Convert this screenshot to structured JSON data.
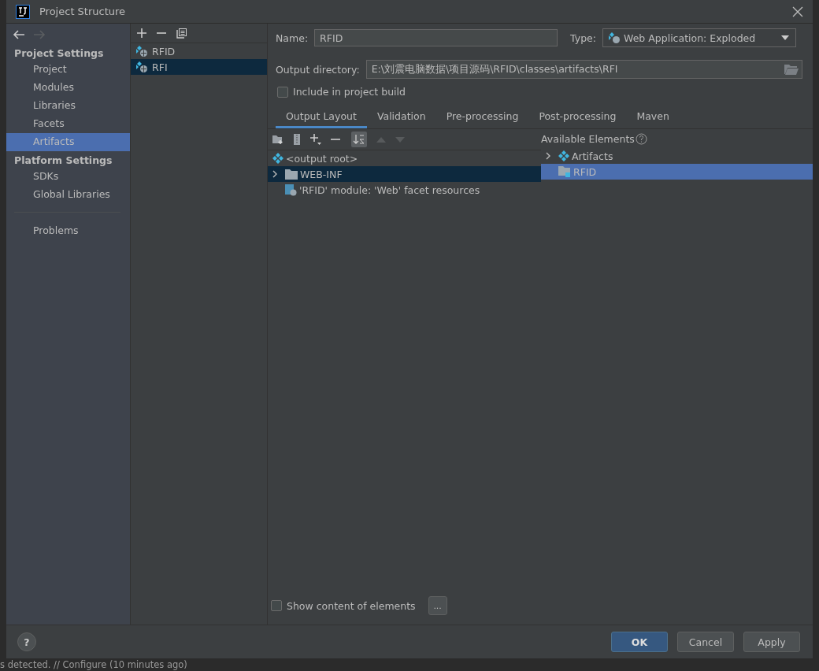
{
  "window": {
    "title": "Project Structure"
  },
  "sidebar": {
    "sections": [
      {
        "heading": "Project Settings",
        "items": [
          {
            "label": "Project",
            "selected": false
          },
          {
            "label": "Modules",
            "selected": false
          },
          {
            "label": "Libraries",
            "selected": false
          },
          {
            "label": "Facets",
            "selected": false
          },
          {
            "label": "Artifacts",
            "selected": true
          }
        ]
      },
      {
        "heading": "Platform Settings",
        "items": [
          {
            "label": "SDKs",
            "selected": false
          },
          {
            "label": "Global Libraries",
            "selected": false
          }
        ]
      }
    ],
    "extra_items": [
      {
        "label": "Problems",
        "selected": false
      }
    ]
  },
  "artifacts": [
    {
      "name": "RFID",
      "selected": false
    },
    {
      "name": "RFI",
      "selected": true
    }
  ],
  "form": {
    "name_label": "Name:",
    "name_value": "RFID",
    "type_label": "Type:",
    "type_value": "Web Application: Exploded",
    "output_label": "Output directory:",
    "output_value": "E:\\刘震电脑数据\\项目源码\\RFID\\classes\\artifacts\\RFI",
    "include_label": "Include in project build",
    "include_checked": false
  },
  "tabs": [
    {
      "label": "Output Layout",
      "selected": true
    },
    {
      "label": "Validation",
      "selected": false
    },
    {
      "label": "Pre-processing",
      "selected": false
    },
    {
      "label": "Post-processing",
      "selected": false
    },
    {
      "label": "Maven",
      "selected": false
    }
  ],
  "layout_tree": [
    {
      "label": "<output root>",
      "kind": "artifact",
      "selected": false,
      "children": [
        {
          "label": "WEB-INF",
          "kind": "folder",
          "expanded": false,
          "selected": true
        },
        {
          "label": "'RFID' module: 'Web' facet resources",
          "kind": "facet",
          "selected": false
        }
      ]
    }
  ],
  "available": {
    "title": "Available Elements",
    "items": [
      {
        "label": "Artifacts",
        "kind": "artifact",
        "expanded": false,
        "selected": false
      },
      {
        "label": "RFID",
        "kind": "module",
        "selected": true
      }
    ]
  },
  "show_content": {
    "label": "Show content of elements",
    "checked": false,
    "button": "..."
  },
  "buttons": [
    {
      "label": "OK",
      "kind": "default"
    },
    {
      "label": "Cancel",
      "kind": "plain"
    },
    {
      "label": "Apply",
      "kind": "plain"
    }
  ],
  "help": "?",
  "status_bar": "s detected. // Configure (10 minutes ago)"
}
